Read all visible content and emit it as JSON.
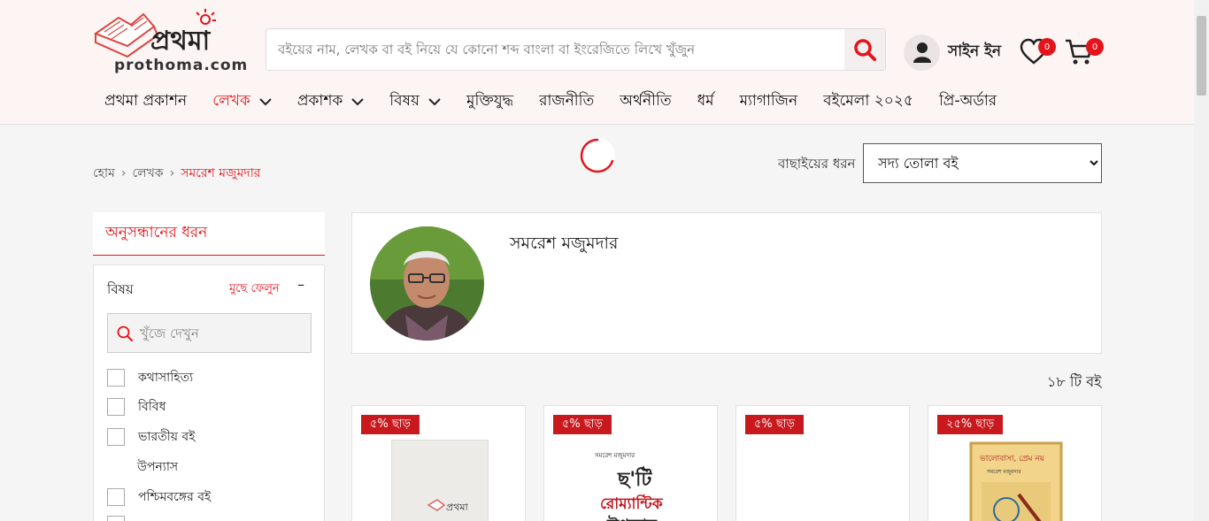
{
  "header": {
    "logo_text": "prothoma.com",
    "search_placeholder": "বইয়ের নাম, লেখক বা বই নিয়ে যে কোনো শব্দ বাংলা বা ইংরেজিতে লিখে খুঁজুন",
    "sign_in": "সাইন ইন",
    "wishlist_count": "0",
    "cart_count": "0",
    "accent_color": "#e4141b"
  },
  "nav": {
    "items": [
      {
        "label": "প্রথমা প্রকাশন"
      },
      {
        "label": "লেখক"
      },
      {
        "label": "প্রকাশক"
      },
      {
        "label": "বিষয়"
      },
      {
        "label": "মুক্তিযুদ্ধ"
      },
      {
        "label": "রাজনীতি"
      },
      {
        "label": "অর্থনীতি"
      },
      {
        "label": "ধর্ম"
      },
      {
        "label": "ম্যাগাজিন"
      },
      {
        "label": "বইমেলা ২০২৫"
      },
      {
        "label": "প্রি-অর্ডার"
      }
    ]
  },
  "breadcrumb": {
    "home": "হোম",
    "section": "লেখক",
    "current": "সমরেশ মজুমদার"
  },
  "sort": {
    "label": "বাছাইয়ের ধরন",
    "selected": "সদ্য তোলা বই"
  },
  "filter": {
    "heading": "অনুসন্ধানের ধরন",
    "group_title": "বিষয়",
    "clear": "মুছে ফেলুন",
    "collapse": "–",
    "search_placeholder": "খুঁজে দেখুন",
    "options": [
      {
        "label": "কথাসাহিত্য"
      },
      {
        "label": "বিবিধ"
      },
      {
        "label": "ভারতীয় বই"
      },
      {
        "label": "উপন্যাস"
      },
      {
        "label": "পশ্চিমবঙ্গের বই"
      }
    ]
  },
  "author": {
    "name": "সমরেশ মজুমদার"
  },
  "results": {
    "count": "১৮ টি বই"
  },
  "books": [
    {
      "discount": "৫% ছাড়"
    },
    {
      "discount": "৫% ছাড়"
    },
    {
      "discount": "৫% ছাড়"
    },
    {
      "discount": "২৫% ছাড়"
    }
  ]
}
